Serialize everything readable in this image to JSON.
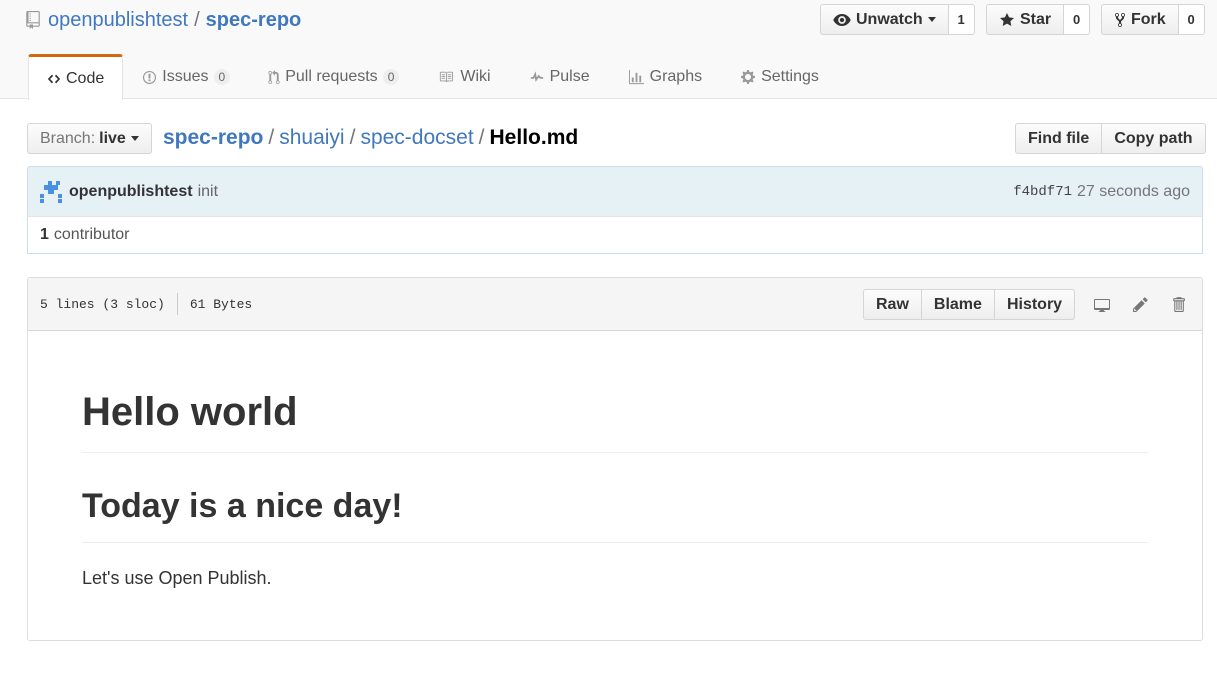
{
  "repo": {
    "owner": "openpublishtest",
    "separator": "/",
    "name": "spec-repo"
  },
  "actions": {
    "watch_label": "Unwatch",
    "watch_count": "1",
    "star_label": "Star",
    "star_count": "0",
    "fork_label": "Fork",
    "fork_count": "0"
  },
  "tabs": [
    {
      "label": "Code",
      "icon": "code-icon"
    },
    {
      "label": "Issues",
      "count": "0",
      "icon": "issue-icon"
    },
    {
      "label": "Pull requests",
      "count": "0",
      "icon": "pull-request-icon"
    },
    {
      "label": "Wiki",
      "icon": "book-icon"
    },
    {
      "label": "Pulse",
      "icon": "pulse-icon"
    },
    {
      "label": "Graphs",
      "icon": "graph-icon"
    },
    {
      "label": "Settings",
      "icon": "gear-icon"
    }
  ],
  "branch": {
    "label": "Branch:",
    "value": "live"
  },
  "breadcrumb": {
    "root": "spec-repo",
    "sep": "/",
    "dir1": "shuaiyi",
    "dir2": "spec-docset",
    "file": "Hello.md"
  },
  "file_buttons": {
    "find": "Find file",
    "copy": "Copy path"
  },
  "commit": {
    "author": "openpublishtest",
    "message": "init",
    "sha": "f4bdf71",
    "time": "27 seconds ago"
  },
  "contributors": {
    "count": "1",
    "label": "contributor"
  },
  "file": {
    "lines": "5 lines (3 sloc)",
    "size": "61 Bytes",
    "raw": "Raw",
    "blame": "Blame",
    "history": "History"
  },
  "content": {
    "h1": "Hello world",
    "h2": "Today is a nice day!",
    "p": "Let's use Open Publish."
  },
  "colors": {
    "link": "#4078c0",
    "tab_accent": "#d26911",
    "commit_bg": "#e6f1f6"
  }
}
